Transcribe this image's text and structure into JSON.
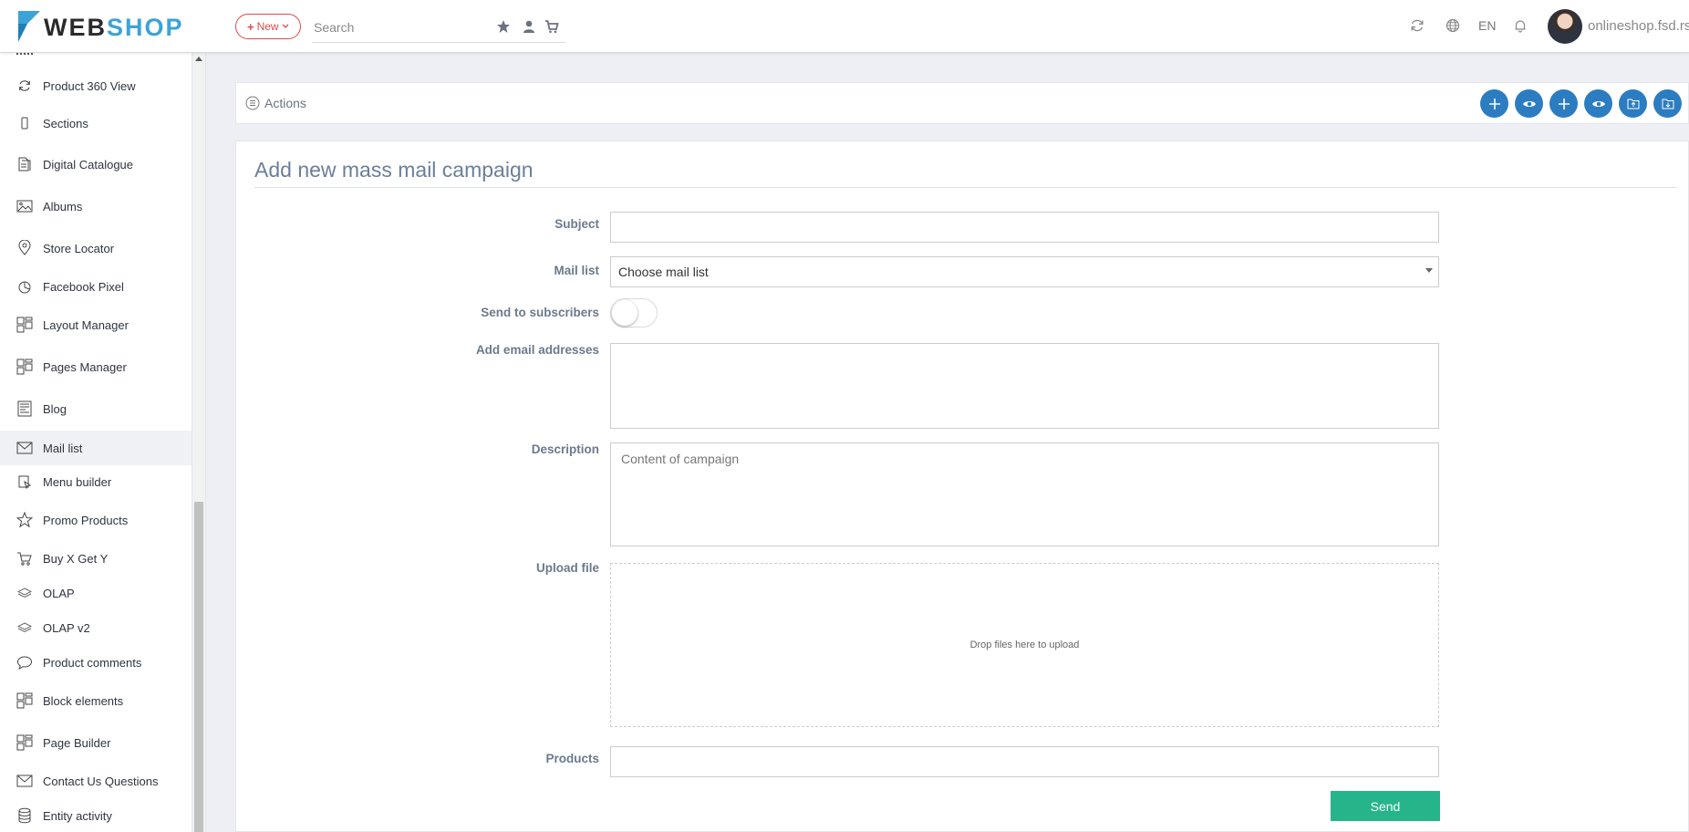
{
  "brand": {
    "logo_web": "WEB",
    "logo_shop": "SHOP"
  },
  "topbar": {
    "new_label": "New",
    "search_placeholder": "Search",
    "language": "EN",
    "domain": "onlineshop.fsd.rs",
    "icons": [
      "star-icon",
      "user-icon",
      "cart-icon",
      "refresh-icon",
      "globe-icon",
      "bell-icon"
    ]
  },
  "sidebar": {
    "items": [
      {
        "label": "Product 360 View",
        "icon": "rotate-icon"
      },
      {
        "label": "Sections",
        "icon": "mobile-icon"
      },
      {
        "label": "Digital Catalogue",
        "icon": "catalogue-icon"
      },
      {
        "label": "Albums",
        "icon": "image-icon"
      },
      {
        "label": "Store Locator",
        "icon": "map-pin-icon"
      },
      {
        "label": "Facebook Pixel",
        "icon": "pie-icon"
      },
      {
        "label": "Layout Manager",
        "icon": "layout-icon"
      },
      {
        "label": "Pages Manager",
        "icon": "layout-icon"
      },
      {
        "label": "Blog",
        "icon": "blog-icon"
      },
      {
        "label": "Mail list",
        "icon": "mail-icon",
        "active": true
      },
      {
        "label": "Menu builder",
        "icon": "menu-builder-icon"
      },
      {
        "label": "Promo Products",
        "icon": "star-outline-icon"
      },
      {
        "label": "Buy X Get Y",
        "icon": "cart-icon"
      },
      {
        "label": "OLAP",
        "icon": "layers-icon"
      },
      {
        "label": "OLAP v2",
        "icon": "layers-icon"
      },
      {
        "label": "Product comments",
        "icon": "comment-icon"
      },
      {
        "label": "Block elements",
        "icon": "layout-icon"
      },
      {
        "label": "Page Builder",
        "icon": "layout-icon"
      },
      {
        "label": "Contact Us Questions",
        "icon": "mail-icon"
      },
      {
        "label": "Entity activity",
        "icon": "database-icon"
      }
    ]
  },
  "actions": {
    "label": "Actions",
    "buttons": [
      "plus-icon",
      "eye-icon",
      "plus-icon",
      "eye-icon",
      "folder-export-icon",
      "folder-import-icon"
    ]
  },
  "form": {
    "title": "Add new mass mail campaign",
    "subject_label": "Subject",
    "subject_value": "",
    "maillist_label": "Mail list",
    "maillist_value": "Choose mail list",
    "send_to_subscribers_label": "Send to subscribers",
    "send_to_subscribers_on": false,
    "add_emails_label": "Add email addresses",
    "description_label": "Description",
    "description_placeholder": "Content of campaign",
    "upload_label": "Upload file",
    "upload_hint": "Drop files here to upload",
    "products_label": "Products",
    "send_label": "Send"
  },
  "colors": {
    "accent": "#2c7cc1",
    "brand_blue": "#3ca3d6",
    "new_red": "#e04a4a",
    "send_green": "#26b48b"
  }
}
